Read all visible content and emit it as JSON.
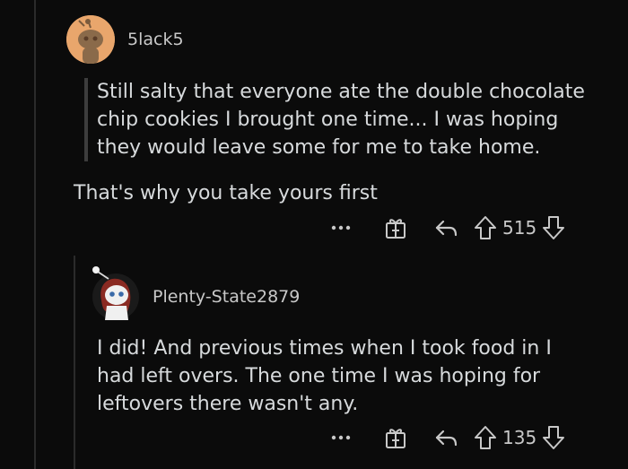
{
  "comments": [
    {
      "username": "5lack5",
      "avatar_icon": "snoo-avatar-icon",
      "avatar_bg": "#e9a66c",
      "quoted_text": "Still salty that everyone ate the double chocolate chip cookies I brought one time... I was hoping they would leave some for me to take home.",
      "text": "That's why you take yours first",
      "score": "515"
    },
    {
      "username": "Plenty-State2879",
      "avatar_icon": "snoo-avatar-icon",
      "avatar_bg": "#1a1a1a",
      "text": "I did! And previous times when I took food in I had left overs. The one time I was hoping for leftovers there wasn't any.",
      "score": "135"
    }
  ],
  "actions": {
    "more_icon": "more-options-icon",
    "award_icon": "award-gift-icon",
    "reply_icon": "reply-arrow-icon",
    "upvote_icon": "upvote-arrow-icon",
    "downvote_icon": "downvote-arrow-icon",
    "more_label": "•••"
  }
}
